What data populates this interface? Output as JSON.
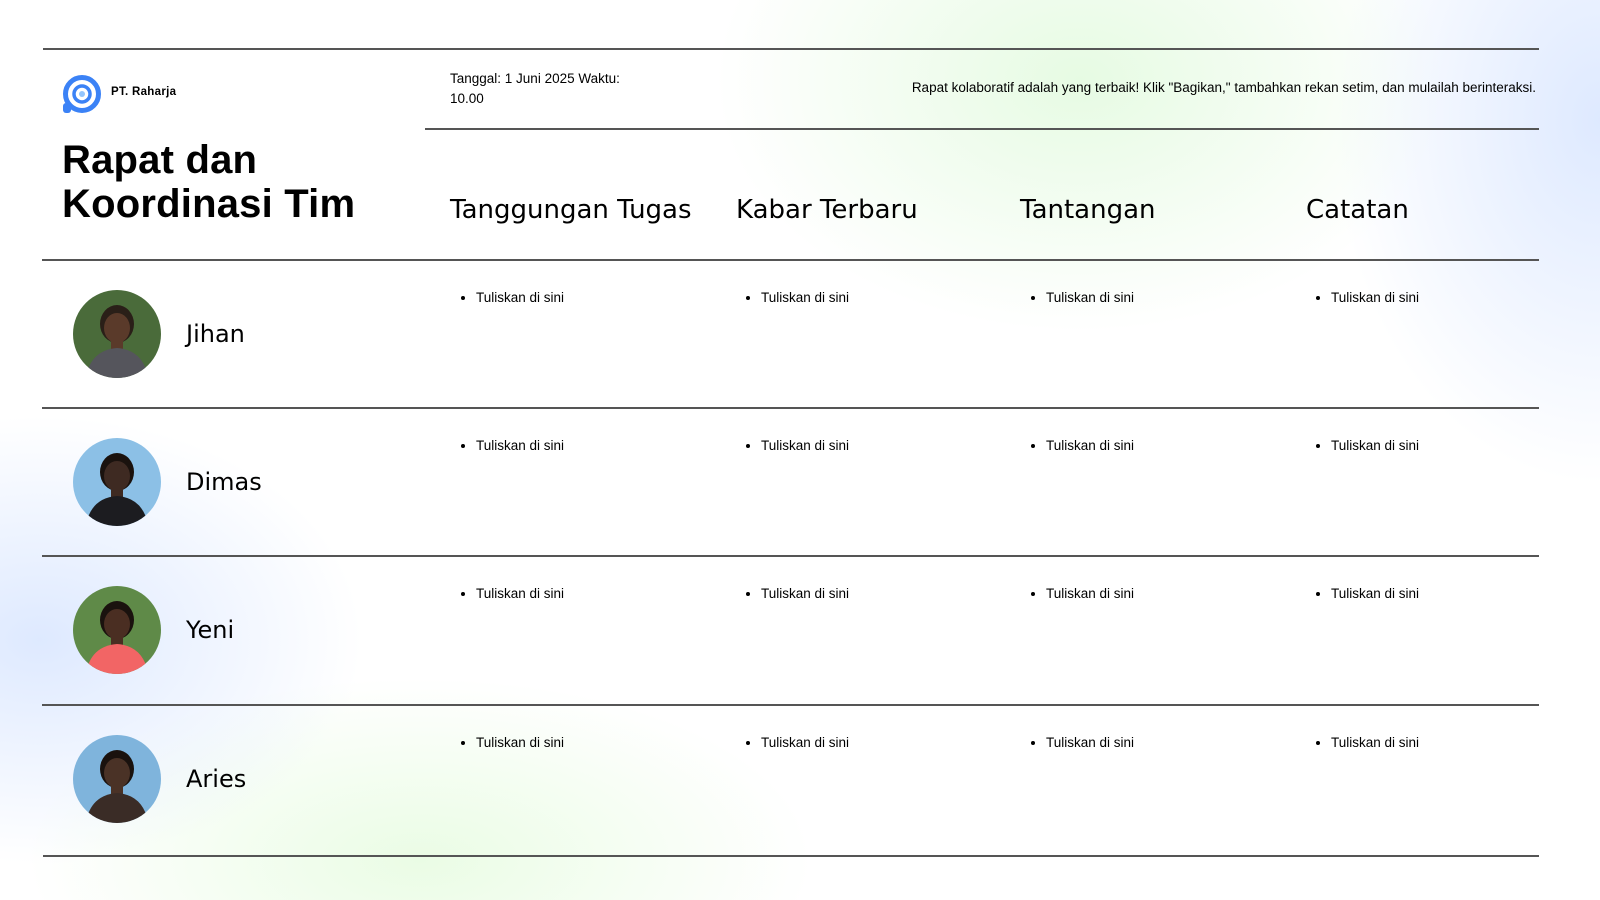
{
  "header": {
    "company": "PT. Raharja",
    "meta": "Tanggal: 1 Juni 2025 Waktu: 10.00",
    "tagline": "Rapat kolaboratif adalah yang terbaik! Klik \"Bagikan,\" tambahkan rekan setim, dan mulailah berinteraksi.",
    "title": "Rapat dan Koordinasi Tim",
    "logo_icon": "circle-logo-icon",
    "accent_color": "#3b82f6"
  },
  "columns": [
    "Tanggungan Tugas",
    "Kabar Terbaru",
    "Tantangan",
    "Catatan"
  ],
  "members": [
    {
      "name": "Jihan",
      "avatar_icon": "avatar-photo-icon",
      "avatar_colors": {
        "bg": "#4a6b3a",
        "skin": "#5a3a2a",
        "hair": "#2a1f18",
        "cloth": "#55555c"
      },
      "cells": [
        "Tuliskan di sini",
        "Tuliskan di sini",
        "Tuliskan di sini",
        "Tuliskan di sini"
      ]
    },
    {
      "name": "Dimas",
      "avatar_icon": "avatar-photo-icon",
      "avatar_colors": {
        "bg": "#8cc0e6",
        "skin": "#3e2a22",
        "hair": "#1a120e",
        "cloth": "#1c1c20"
      },
      "cells": [
        "Tuliskan di sini",
        "Tuliskan di sini",
        "Tuliskan di sini",
        "Tuliskan di sini"
      ]
    },
    {
      "name": "Yeni",
      "avatar_icon": "avatar-photo-icon",
      "avatar_colors": {
        "bg": "#5f8a48",
        "skin": "#4a2e22",
        "hair": "#1a120e",
        "cloth": "#f26565"
      },
      "cells": [
        "Tuliskan di sini",
        "Tuliskan di sini",
        "Tuliskan di sini",
        "Tuliskan di sini"
      ]
    },
    {
      "name": "Aries",
      "avatar_icon": "avatar-photo-icon",
      "avatar_colors": {
        "bg": "#7fb4dc",
        "skin": "#4a3226",
        "hair": "#1a120e",
        "cloth": "#3a2c26"
      },
      "cells": [
        "Tuliskan di sini",
        "Tuliskan di sini",
        "Tuliskan di sini",
        "Tuliskan di sini"
      ]
    }
  ]
}
